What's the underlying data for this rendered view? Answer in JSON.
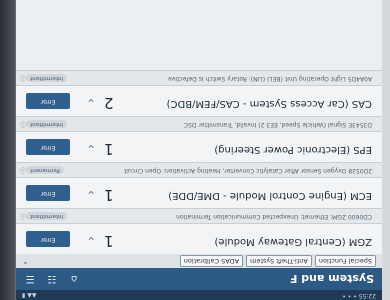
{
  "status_bar": {
    "time": "22:55 • • •",
    "icons": "▲▲ ▮"
  },
  "header": {
    "title": "System and F"
  },
  "tabs": [
    "Special Function",
    "Anti-Theft System",
    "ADAS Calibration"
  ],
  "rows": [
    {
      "kind": "module",
      "name": "ZGM (Central Gateway Module)",
      "count": "1",
      "action": "Error"
    },
    {
      "kind": "fault",
      "text": "CD0600 ZGM: Ethernet: Unexpected Communication Termination",
      "status": "Intermittent"
    },
    {
      "kind": "module",
      "name": "ECM (Engine Control Module - DME/DDE)",
      "count": "1",
      "action": "Error"
    },
    {
      "kind": "fault",
      "text": "2D0528 Oxygen Sensor After Catalytic Converter, Heating Activation: Open Circuit",
      "status": "Permanent"
    },
    {
      "kind": "module",
      "name": "EPS (Electronic Power Steering)",
      "count": "1",
      "action": "Error"
    },
    {
      "kind": "fault",
      "text": "D3543E Signal (Vehicle Speed, EE3 2) Invalid, Transmitter DSC",
      "status": "Intermittent"
    },
    {
      "kind": "module",
      "name": "CAS (Car Access System - CAS/FEM/BDC)",
      "count": "2",
      "action": "Error"
    },
    {
      "kind": "fault",
      "text": "A0A4D5 Light Operating Unit (BEL) (LIN): Rotary Switch Is Defective",
      "status": "Intermittent"
    }
  ],
  "colors": {
    "header": "#2d5a85",
    "action": "#2f5f8f"
  },
  "icons": {
    "home": "home-icon",
    "menu": "menu-icon",
    "list": "list-icon",
    "collapse": "chevron-up-icon",
    "row_expand": "chevron-down-icon",
    "fault_info": "info-icon"
  }
}
